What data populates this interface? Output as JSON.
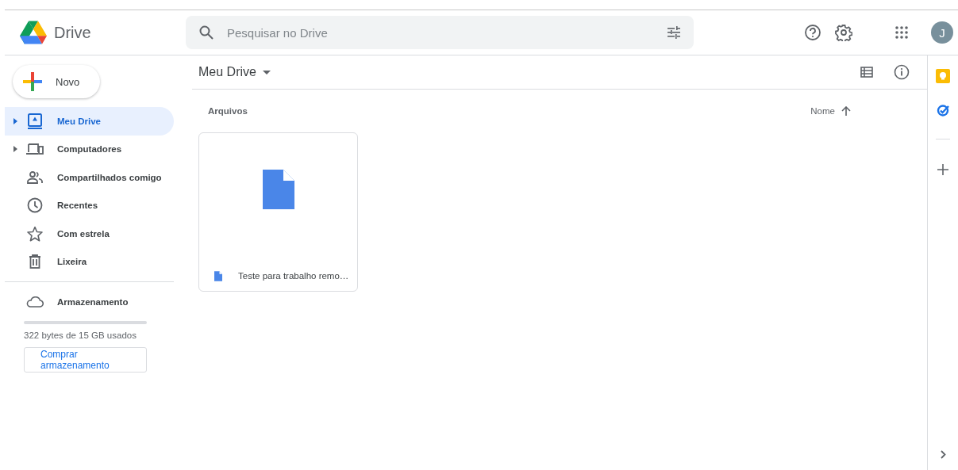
{
  "header": {
    "app_name": "Drive",
    "search": {
      "placeholder": "Pesquisar no Drive"
    },
    "avatar": "J"
  },
  "sidebar": {
    "new_button": "Novo",
    "items": [
      {
        "kind": "drive",
        "label": "Meu Drive",
        "selected": true,
        "expandable": true
      },
      {
        "kind": "computers",
        "label": "Computadores",
        "selected": false,
        "expandable": true
      },
      {
        "kind": "shared",
        "label": "Compartilhados comigo",
        "selected": false,
        "expandable": false
      },
      {
        "kind": "recent",
        "label": "Recentes",
        "selected": false,
        "expandable": false
      },
      {
        "kind": "starred",
        "label": "Com estrela",
        "selected": false,
        "expandable": false
      },
      {
        "kind": "trash",
        "label": "Lixeira",
        "selected": false,
        "expandable": false
      }
    ],
    "storage": {
      "label": "Armazenamento",
      "level": 0,
      "usage": "322 bytes de 15 GB usados",
      "buy_button": "Comprar armazenamento"
    }
  },
  "main": {
    "title": "Meu Drive",
    "section": "Arquivos",
    "sort": "Nome",
    "files": [
      {
        "name": "Teste para trabalho remo…"
      }
    ]
  }
}
